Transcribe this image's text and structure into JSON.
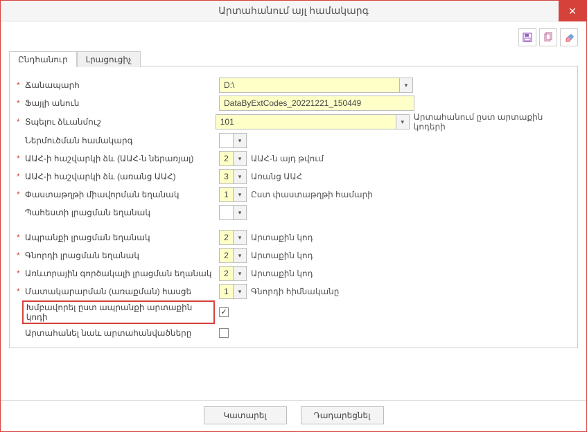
{
  "window": {
    "title": "Արտահանում այլ համակարգ"
  },
  "toolbar": {
    "save": "save",
    "copy": "copy",
    "erase": "erase"
  },
  "tabs": [
    {
      "label": "Ընդհանուր",
      "active": true
    },
    {
      "label": "Լրացուցիչ",
      "active": false
    }
  ],
  "fields": {
    "path": {
      "label": "Ճանապարհ",
      "value": "D:\\"
    },
    "filename": {
      "label": "Ֆայլի անուն",
      "value": "DataByExtCodes_20221221_150449"
    },
    "print_form": {
      "label": "Տպելու ձևանմուշ",
      "value": "101",
      "desc": "Արտահանում ըստ արտաքին կոդերի"
    },
    "import_sys": {
      "label": "Ներմուծման համակարգ",
      "value": ""
    },
    "vat_acct_in": {
      "label": "ԱԱՀ-ի հաշվարկի ձև (ԱԱՀ-ն ներառյալ)",
      "value": "2",
      "desc": "ԱԱՀ-ն այդ թվում"
    },
    "vat_acct_ex": {
      "label": "ԱԱՀ-ի հաշվարկի ձև (առանց ԱԱՀ)",
      "value": "3",
      "desc": "Առանց ԱԱՀ"
    },
    "doc_form": {
      "label": "Փաստաթղթի միավորման եղանակ",
      "value": "1",
      "desc": "Ըստ փաստաթղթի համարի"
    },
    "warehouse": {
      "label": "Պահեստի լրացման եղանակ",
      "value": ""
    },
    "product": {
      "label": "Ապրանքի լրացման եղանակ",
      "value": "2",
      "desc": "Արտաքին կոդ"
    },
    "buyer": {
      "label": "Գնորդի լրացման եղանակ",
      "value": "2",
      "desc": "Արտաքին կոդ"
    },
    "sales_agent": {
      "label": "Առևտրային գործակալի լրացման եղանակ",
      "value": "2",
      "desc": "Արտաքին կոդ"
    },
    "supply_addr": {
      "label": "Մատակարարման (առաքման) հասցե",
      "value": "1",
      "desc": "Գնորդի հիմնականը"
    },
    "group_by": {
      "label": "Խմբավորել ըստ ապրանքի արտաքին կոդի",
      "checked": true
    },
    "export_also": {
      "label": "Արտահանել նաև արտահանվածները",
      "checked": false
    }
  },
  "footer": {
    "execute": "Կատարել",
    "cancel": "Դադարեցնել"
  }
}
